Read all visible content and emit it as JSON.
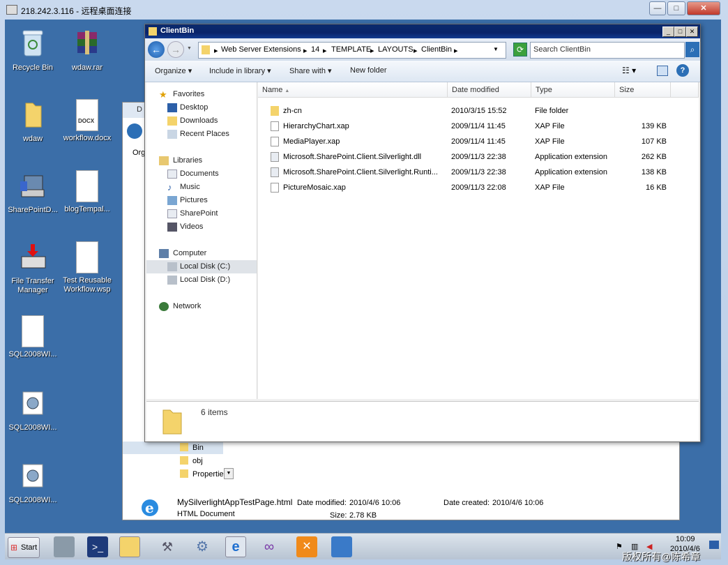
{
  "rdp": {
    "title": "218.242.3.116 - 远程桌面连接",
    "min": "—",
    "max": "□",
    "close": "✕"
  },
  "desktop_icons": [
    {
      "name": "recycle-bin",
      "label": "Recycle Bin"
    },
    {
      "name": "wdaw-rar",
      "label": "wdaw.rar"
    },
    {
      "name": "wdaw-folder",
      "label": "wdaw"
    },
    {
      "name": "workflow-docx",
      "label": "workflow.docx"
    },
    {
      "name": "sharepoint-shortcut",
      "label": "SharePointD..."
    },
    {
      "name": "blogtempal",
      "label": "blogTempal..."
    },
    {
      "name": "file-transfer-manager",
      "label": "File Transfer Manager"
    },
    {
      "name": "test-reusable-workflow",
      "label": "Test Reusable Workflow.wsp"
    },
    {
      "name": "sql2008-1",
      "label": "SQL2008WI..."
    },
    {
      "name": "sql2008-2",
      "label": "SQL2008WI..."
    },
    {
      "name": "sql2008-3",
      "label": "SQL2008WI..."
    }
  ],
  "docx_badge": "DOCX",
  "window": {
    "title": "ClientBin",
    "breadcrumb": [
      "Web Server Extensions",
      "14",
      "TEMPLATE",
      "LAYOUTS",
      "ClientBin"
    ],
    "search_placeholder": "Search ClientBin",
    "toolbar": {
      "organize": "Organize",
      "include": "Include in library",
      "share": "Share with",
      "new_folder": "New folder"
    },
    "nav": {
      "favorites": "Favorites",
      "desktop": "Desktop",
      "downloads": "Downloads",
      "recent": "Recent Places",
      "libraries": "Libraries",
      "documents": "Documents",
      "music": "Music",
      "pictures": "Pictures",
      "sharepoint": "SharePoint",
      "videos": "Videos",
      "computer": "Computer",
      "local_c": "Local Disk (C:)",
      "local_d": "Local Disk (D:)",
      "network": "Network"
    },
    "columns": {
      "name": "Name",
      "date": "Date modified",
      "type": "Type",
      "size": "Size"
    },
    "rows": [
      {
        "name": "zh-cn",
        "date": "2010/3/15 15:52",
        "type": "File folder",
        "size": ""
      },
      {
        "name": "HierarchyChart.xap",
        "date": "2009/11/4 11:45",
        "type": "XAP File",
        "size": "139 KB"
      },
      {
        "name": "MediaPlayer.xap",
        "date": "2009/11/4 11:45",
        "type": "XAP File",
        "size": "107 KB"
      },
      {
        "name": "Microsoft.SharePoint.Client.Silverlight.dll",
        "date": "2009/11/3 22:38",
        "type": "Application extension",
        "size": "262 KB"
      },
      {
        "name": "Microsoft.SharePoint.Client.Silverlight.Runti...",
        "date": "2009/11/3 22:38",
        "type": "Application extension",
        "size": "138 KB"
      },
      {
        "name": "PictureMosaic.xap",
        "date": "2009/11/3 22:08",
        "type": "XAP File",
        "size": "16 KB"
      }
    ],
    "status": "6 items"
  },
  "bg_window": {
    "title_fragment": "D",
    "org_fragment": "Org",
    "tree": [
      "Bin",
      "obj",
      "Propertie"
    ],
    "detail": {
      "filename": "MySilverlightAppTestPage.html",
      "filetype": "HTML Document",
      "modified_label": "Date modified:",
      "modified": "2010/4/6 10:06",
      "created_label": "Date created:",
      "created": "2010/4/6 10:06",
      "size_label": "Size:",
      "size": "2.78 KB"
    }
  },
  "taskbar": {
    "start": "Start",
    "time": "10:09",
    "date": "2010/4/6"
  },
  "watermark": "版权所有@陈希章"
}
